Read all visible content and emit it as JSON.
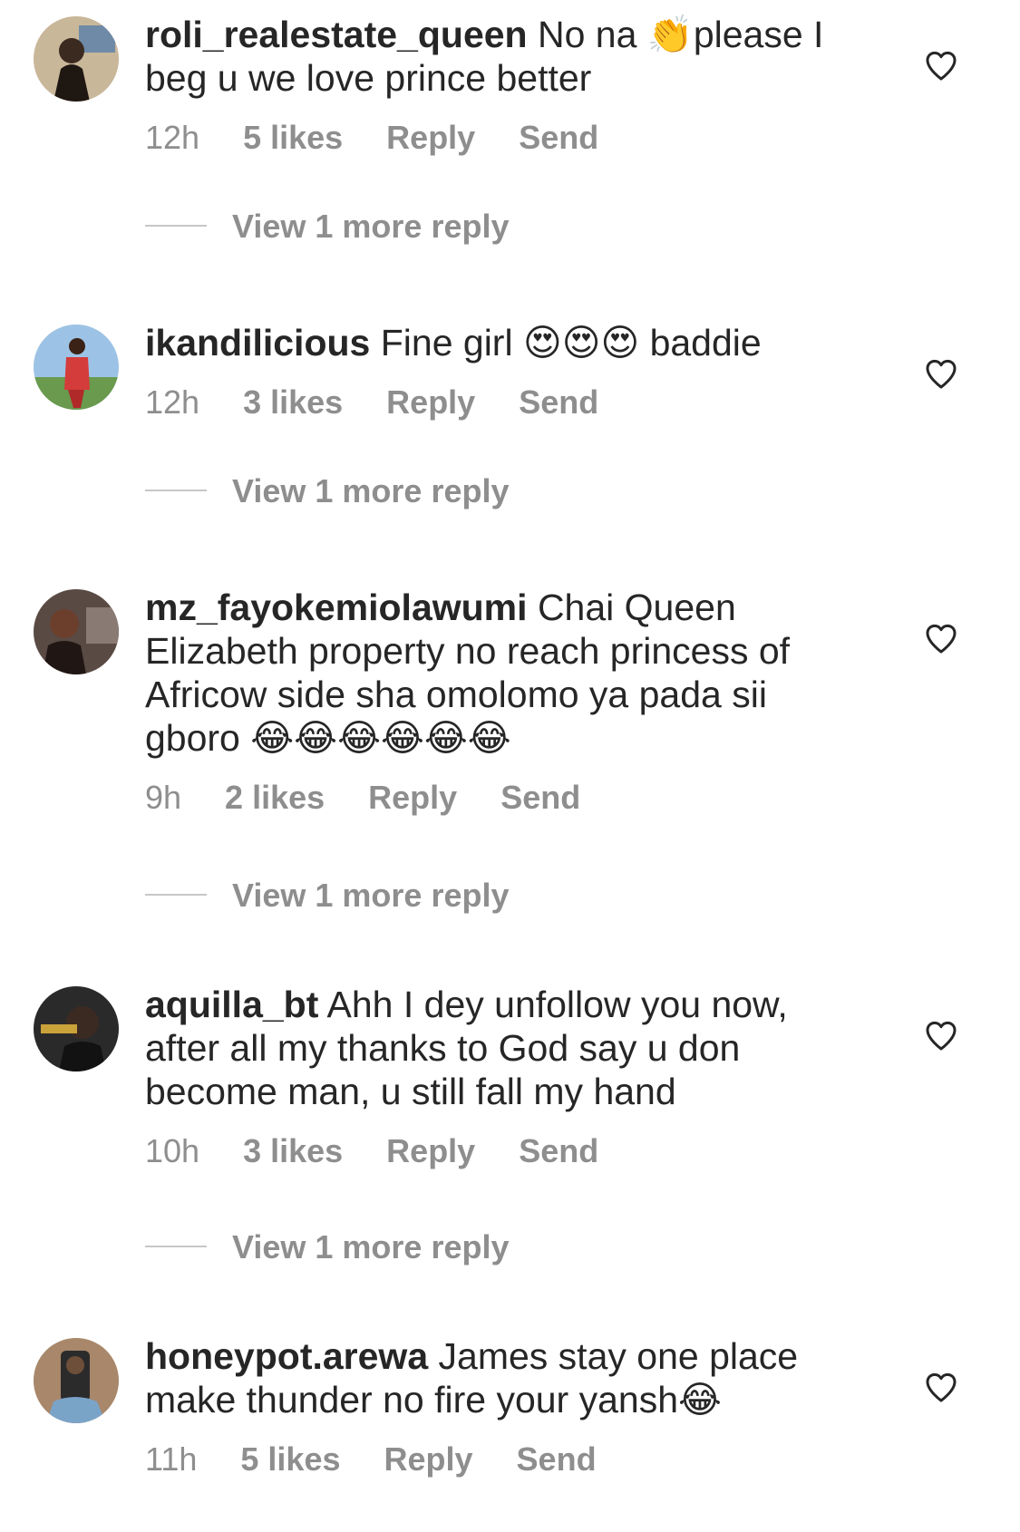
{
  "comments": [
    {
      "username": "roli_realestate_queen",
      "text": "No na 👏please I beg u we love prince better",
      "time": "12h",
      "likes": "5 likes",
      "reply": "Reply",
      "send": "Send",
      "view_more": "View 1 more reply",
      "avatar_icon": "avatar-photo"
    },
    {
      "username": "ikandilicious",
      "text": "Fine girl 😍😍😍 baddie",
      "time": "12h",
      "likes": "3 likes",
      "reply": "Reply",
      "send": "Send",
      "view_more": "View 1 more reply",
      "avatar_icon": "avatar-photo"
    },
    {
      "username": "mz_fayokemiolawumi",
      "text": "Chai Queen Elizabeth property no reach princess of Africow side sha omolomo ya pada sii gboro 😂😂😂😂😂😂",
      "time": "9h",
      "likes": "2 likes",
      "reply": "Reply",
      "send": "Send",
      "view_more": "View 1 more reply",
      "avatar_icon": "avatar-photo"
    },
    {
      "username": "aquilla_bt",
      "text": "Ahh I dey unfollow you now, after all my thanks to God say u don become man, u still fall my hand",
      "time": "10h",
      "likes": "3 likes",
      "reply": "Reply",
      "send": "Send",
      "view_more": "View 1 more reply",
      "avatar_icon": "avatar-photo"
    },
    {
      "username": "honeypot.arewa",
      "text": "James stay one place make thunder no fire your yansh😂",
      "time": "11h",
      "likes": "5 likes",
      "reply": "Reply",
      "send": "Send",
      "avatar_icon": "avatar-photo"
    }
  ],
  "colors": {
    "text": "#262626",
    "secondary": "#8e8e8e",
    "divider": "#c7c7c7",
    "background": "#ffffff"
  },
  "icons": {
    "like": "heart-outline-icon"
  }
}
